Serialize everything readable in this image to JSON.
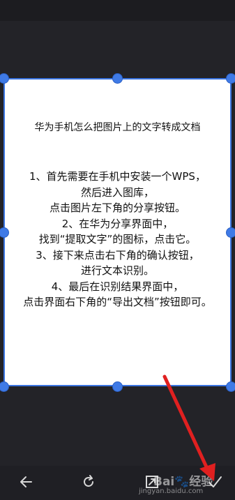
{
  "document": {
    "title": "华为手机怎么把图片上的文字转成文档",
    "lines": [
      "1、首先需要在手机中安装一个WPS，",
      "然后进入图库，",
      "点击图片左下角的分享按钮。",
      "2、在华为分享界面中，",
      "找到“提取文字”的图标，点击它。",
      "3、接下来点击右下角的确认按钮，",
      "进行文本识别。",
      "4、最后在识别结果界面中，",
      "点击界面右下角的“导出文档”按钮即可。"
    ]
  },
  "toolbar": {
    "back_icon": "back-arrow-icon",
    "rotate_icon": "rotate-icon",
    "expand_icon": "expand-icon",
    "confirm_icon": "check-icon"
  },
  "watermark": {
    "logo_text": "Bai🐾经验",
    "url_text": "jingyan.baidu.com"
  },
  "colors": {
    "accent": "#3f7ae6",
    "annotation_arrow": "#e02020",
    "background": "#232328"
  }
}
